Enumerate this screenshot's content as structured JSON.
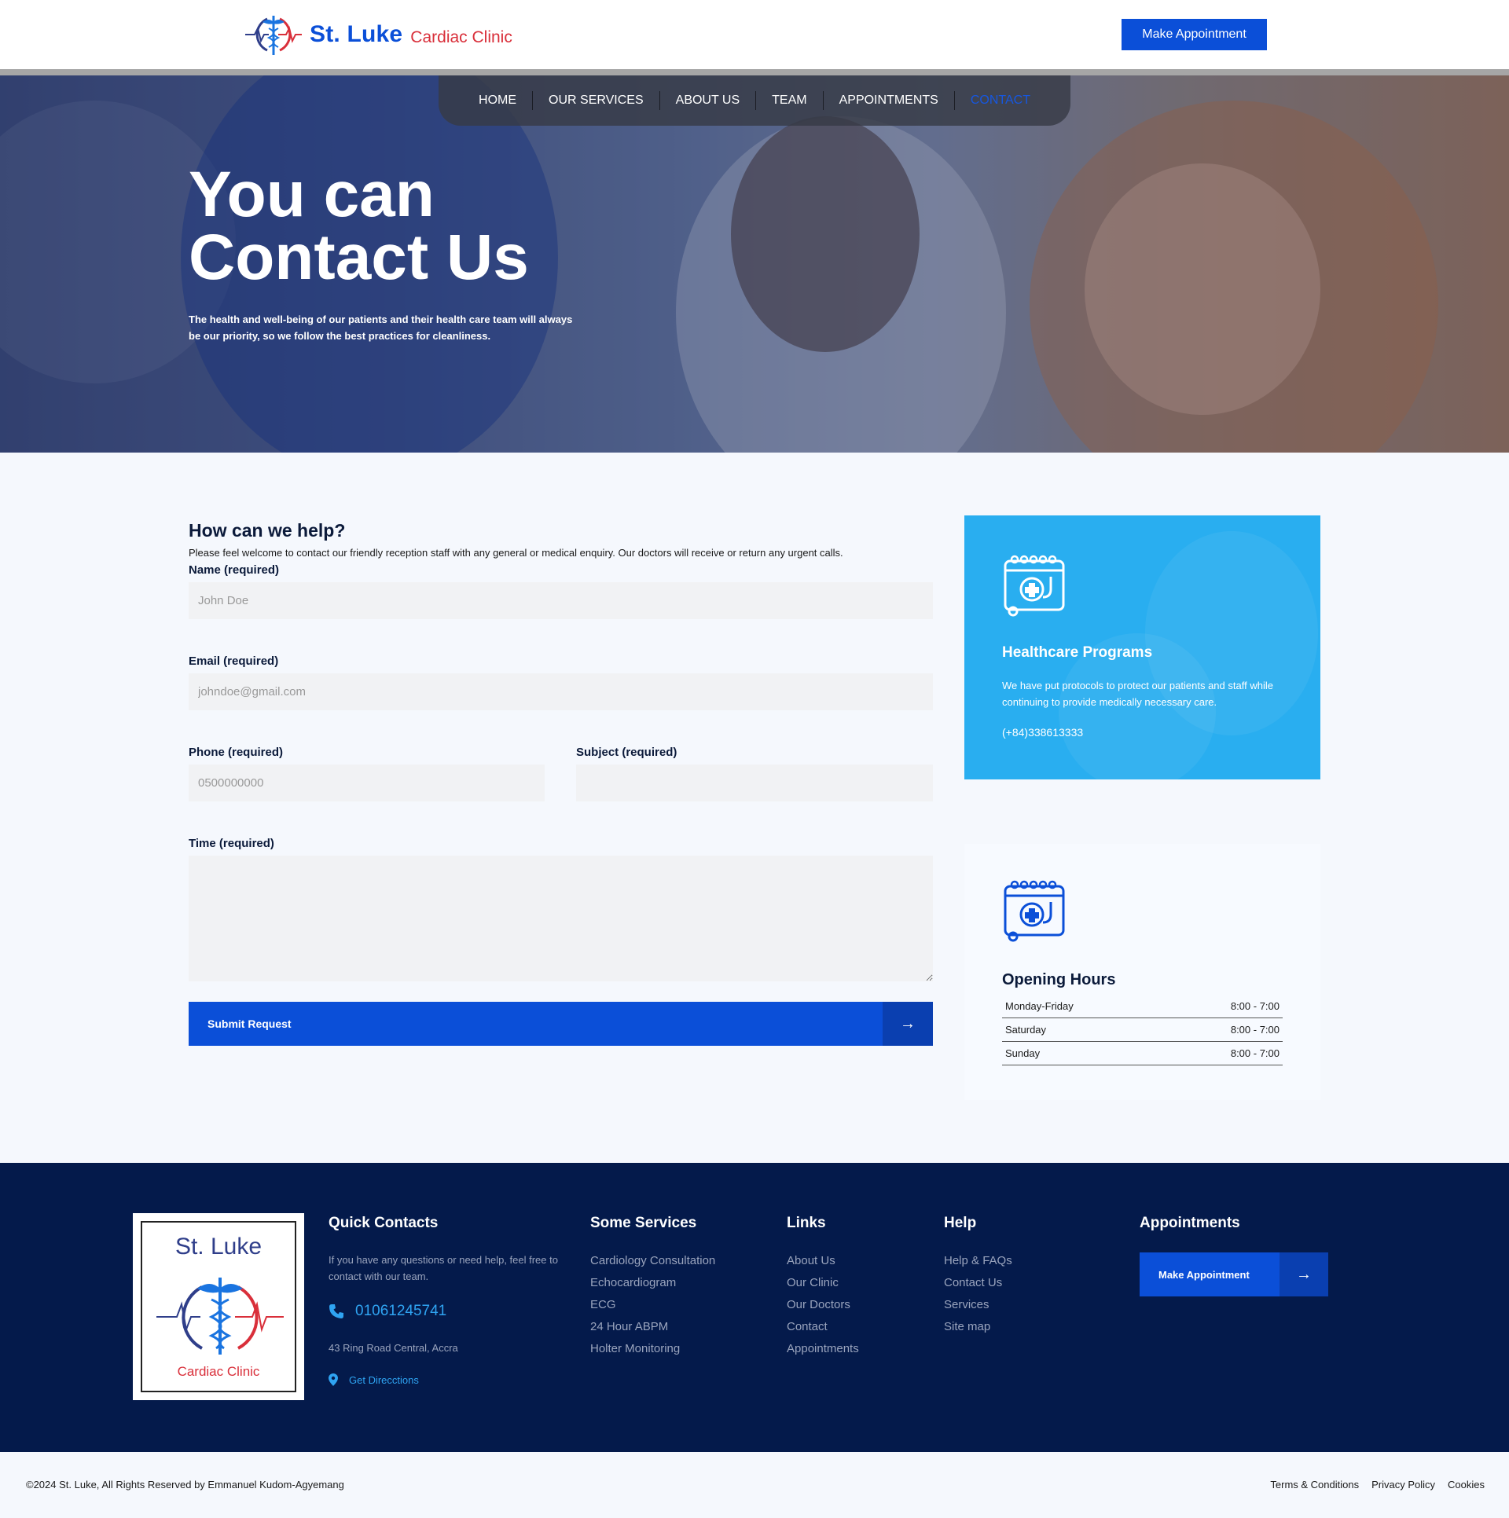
{
  "header": {
    "logo_name": "St. Luke",
    "logo_sub": "Cardiac Clinic",
    "cta_label": "Make Appointment"
  },
  "nav": {
    "items": [
      "HOME",
      "OUR SERVICES",
      "ABOUT US",
      "TEAM",
      "APPOINTMENTS",
      "CONTACT"
    ],
    "active": "CONTACT"
  },
  "hero": {
    "title_line1": "You can",
    "title_line2": "Contact Us",
    "text": "The health and well-being of our patients and their health care team will always be our priority, so we follow the best practices for cleanliness."
  },
  "form": {
    "title": "How can we help?",
    "intro": "Please feel welcome to contact our friendly reception staff with any general or medical enquiry. Our doctors will receive or return any urgent calls.",
    "name_label": "Name (required)",
    "name_placeholder": "John Doe",
    "email_label": "Email (required)",
    "email_placeholder": "johndoe@gmail.com",
    "phone_label": "Phone (required)",
    "phone_placeholder": "0500000000",
    "subject_label": "Subject (required)",
    "time_label": "Time (required)",
    "submit_label": "Submit Request"
  },
  "programs": {
    "title": "Healthcare Programs",
    "text": "We have put protocols to protect our patients and staff while continuing to provide medically necessary care.",
    "phone": "(+84)338613333"
  },
  "hours": {
    "title": "Opening Hours",
    "rows": [
      {
        "day": "Monday-Friday",
        "time": "8:00 - 7:00"
      },
      {
        "day": "Saturday",
        "time": "8:00 - 7:00"
      },
      {
        "day": "Sunday",
        "time": "8:00 - 7:00"
      }
    ]
  },
  "footer": {
    "logo_name": "St. Luke",
    "logo_sub": "Cardiac Clinic",
    "quick": {
      "title": "Quick Contacts",
      "text": "If you have any questions or need help, feel free to contact with our team.",
      "phone": "01061245741",
      "address": "43 Ring Road Central, Accra",
      "directions": "Get Direcctions"
    },
    "services": {
      "title": "Some Services",
      "items": [
        "Cardiology Consultation",
        "Echocardiogram",
        "ECG",
        "24 Hour ABPM",
        "Holter Monitoring"
      ]
    },
    "links": {
      "title": "Links",
      "items": [
        "About Us",
        "Our Clinic",
        "Our Doctors",
        "Contact",
        "Appointments"
      ]
    },
    "help": {
      "title": "Help",
      "items": [
        "Help & FAQs",
        "Contact Us",
        "Services",
        "Site map"
      ]
    },
    "appointments": {
      "title": "Appointments",
      "button": "Make Appointment"
    }
  },
  "bottom": {
    "copyright": "©2024 St. Luke, All Rights Reserved by Emmanuel Kudom-Agyemang",
    "legal": [
      "Terms & Conditions",
      "Privacy Policy",
      "Cookies"
    ]
  },
  "colors": {
    "brand_blue": "#0b4fd8",
    "accent_red": "#d92f3a",
    "card_blue": "#29aef0",
    "footer_navy": "#041a4b"
  }
}
